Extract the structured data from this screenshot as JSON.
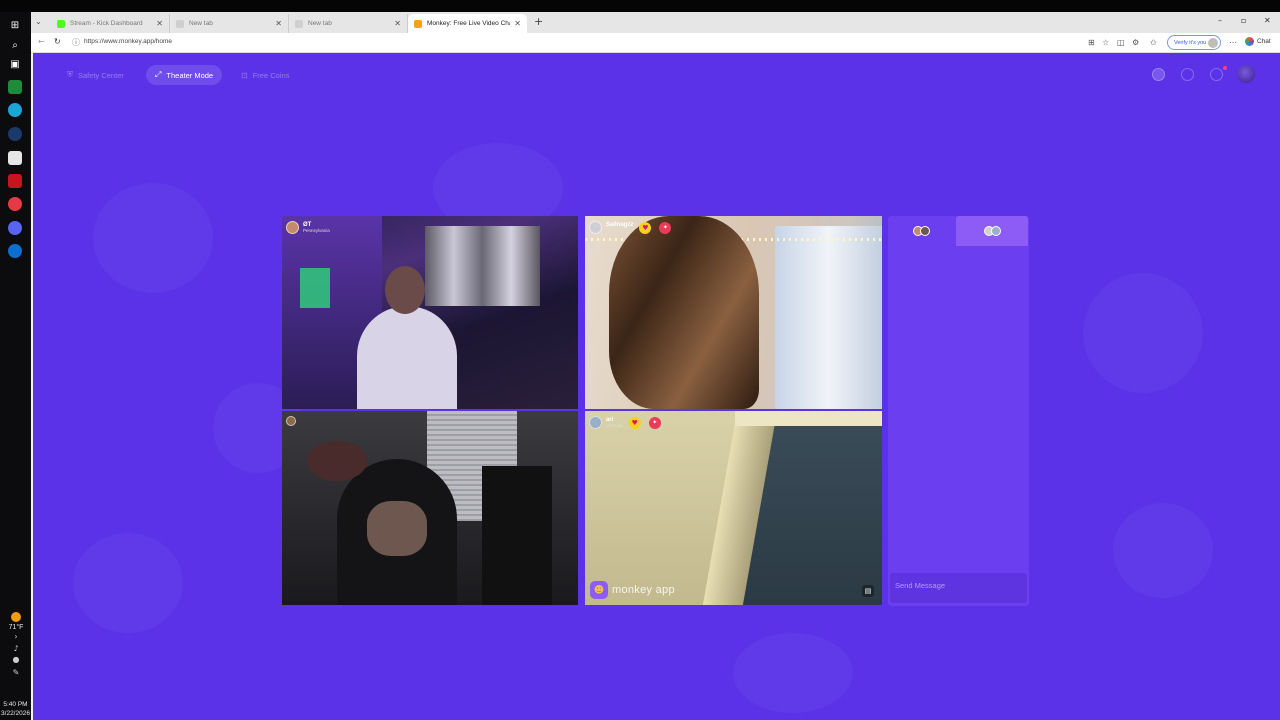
{
  "taskbar": {
    "icons": [
      "windows-start-icon",
      "search-icon",
      "task-view-icon",
      "xbox-app-icon",
      "edge-browser-icon",
      "steam-icon",
      "store-icon",
      "acrobat-icon",
      "recorder-icon",
      "discord-icon",
      "edge-alt-icon"
    ],
    "weather_temp": "71°F",
    "clock_time": "5:40 PM",
    "clock_date": "3/22/2026"
  },
  "browser": {
    "tabs": [
      {
        "title": "Stream - Kick Dashboard",
        "icon": "kick-icon",
        "color": "#53fc18"
      },
      {
        "title": "New tab",
        "icon": "new-tab-icon",
        "color": "#bdbdbd"
      },
      {
        "title": "New tab",
        "icon": "new-tab-icon",
        "color": "#bdbdbd"
      },
      {
        "title": "Monkey: Free Live Video Chat",
        "icon": "monkey-icon",
        "color": "#f6a21a",
        "active": true
      }
    ],
    "url": "https://www.monkey.app/home",
    "verify_label": "Verify it's you",
    "chat_label": "Chat"
  },
  "page": {
    "accent": "#5b32e8",
    "nav": {
      "safety_center": "Safety Center",
      "theater_mode": "Theater Mode",
      "free_coins": "Free Coins"
    },
    "tiles": [
      {
        "name": "ØT",
        "location": "Pennsylvania",
        "has_heart": false
      },
      {
        "name": "",
        "location": "",
        "has_heart": false
      },
      {
        "name": "Sallnagzz",
        "location": "Vermont",
        "has_heart": true
      },
      {
        "name": "ari",
        "location": "Vermont",
        "has_heart": true
      }
    ],
    "brand_text": "monkey app",
    "chat": {
      "placeholder": "Send Message"
    }
  }
}
